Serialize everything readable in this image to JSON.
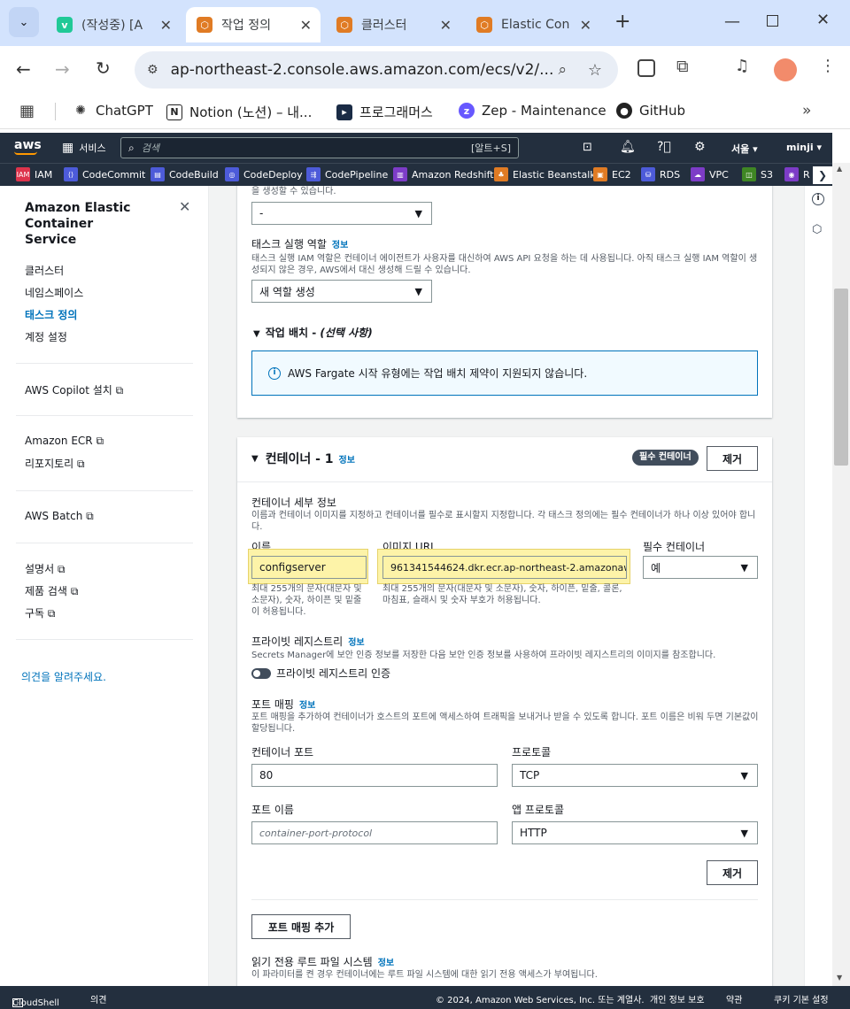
{
  "browser": {
    "tabs": [
      {
        "label": "(작성중) [A",
        "active": false
      },
      {
        "label": "작업 정의",
        "active": true
      },
      {
        "label": "클러스터",
        "active": false
      },
      {
        "label": "Elastic Con",
        "active": false
      }
    ],
    "url": "ap-northeast-2.console.aws.amazon.com/ecs/v2/...",
    "bookmarks": [
      "ChatGPT",
      "Notion (노션) – 내...",
      "프로그래머스",
      "Zep - Maintenance",
      "GitHub"
    ]
  },
  "aws_nav": {
    "logo": "aws",
    "services": "서비스",
    "search_placeholder": "검색",
    "search_shortcut": "[알트+S]",
    "region": "서울",
    "user": "minji",
    "favorites": [
      "IAM",
      "CodeCommit",
      "CodeBuild",
      "CodeDeploy",
      "CodePipeline",
      "Amazon Redshift",
      "Elastic Beanstalk",
      "EC2",
      "RDS",
      "VPC",
      "S3",
      "R"
    ]
  },
  "sidebar": {
    "title": "Amazon Elastic Container Service",
    "items": [
      "클러스터",
      "네임스페이스",
      "태스크 정의",
      "계정 설정"
    ],
    "active": "태스크 정의",
    "copilot": "AWS Copilot 설치",
    "ecr": "Amazon ECR",
    "repos": "리포지토리",
    "batch": "AWS Batch",
    "docs": "설명서",
    "product_search": "제품 검색",
    "subscribe": "구독",
    "feedback": "의견을 알려주세요."
  },
  "top_panel": {
    "cut_text": "을 생성할 수 있습니다.",
    "select_dash": "-",
    "exec_role_label": "태스크 실행 역할",
    "info": "정보",
    "exec_role_desc": "태스크 실행 IAM 역할은 컨테이너 에이전트가 사용자를 대신하여 AWS API 요청을 하는 데 사용됩니다. 아직 태스크 실행 IAM 역할이 생성되지 않은 경우, AWS에서 대신 생성해 드릴 수 있습니다.",
    "exec_role_value": "새 역할 생성",
    "placement_label": "작업 배치 - ",
    "placement_optional": "(선택 사항)",
    "placement_alert": "AWS Fargate 시작 유형에는 작업 배치 제약이 지원되지 않습니다."
  },
  "container": {
    "title": "컨테이너 - 1",
    "info": "정보",
    "essential_badge": "필수 컨테이너",
    "remove_button": "제거",
    "details_label": "컨테이너 세부 정보",
    "details_desc": "이름과 컨테이너 이미지를 지정하고 컨테이너를 필수로 표시할지 지정합니다. 각 태스크 정의에는 필수 컨테이너가 하나 이상 있어야 합니다.",
    "name_label": "이름",
    "name_value": "configserver",
    "name_hint": "최대 255개의 문자(대문자 및 소문자), 숫자, 하이픈 및 밑줄이 허용됩니다.",
    "image_label": "이미지 URI",
    "image_value": "961341544624.dkr.ecr.ap-northeast-2.amazonaw",
    "image_hint": "최대 255개의 문자(대문자 및 소문자), 숫자, 하이픈, 밑줄, 콜론, 마침표, 슬래시 및 숫자 부호가 허용됩니다.",
    "essential_label": "필수 컨테이너",
    "essential_value": "예",
    "private_reg_label": "프라이빗 레지스트리",
    "private_reg_desc": "Secrets Manager에 보안 인증 정보를 저장한 다음 보안 인증 정보를 사용하여 프라이빗 레지스트리의 이미지를 참조합니다.",
    "private_reg_toggle": "프라이빗 레지스트리 인증",
    "port_mapping_label": "포트 매핑",
    "port_mapping_desc": "포트 매핑을 추가하여 컨테이너가 호스트의 포트에 액세스하여 트래픽을 보내거나 받을 수 있도록 합니다. 포트 이름은 비워 두면 기본값이 할당됩니다.",
    "container_port_label": "컨테이너 포트",
    "container_port_value": "80",
    "protocol_label": "프로토콜",
    "protocol_value": "TCP",
    "port_name_label": "포트 이름",
    "port_name_placeholder": "container-port-protocol",
    "app_protocol_label": "앱 프로토콜",
    "app_protocol_value": "HTTP",
    "port_remove": "제거",
    "add_port_mapping": "포트 매핑 추가",
    "readonly_fs_label": "읽기 전용 루트 파일 시스템",
    "readonly_fs_desc": "이 파라미터를 켠 경우 컨테이너에는 루트 파일 시스템에 대한 읽기 전용 액세스가 부여됩니다."
  },
  "footer": {
    "cloudshell": "CloudShell",
    "feedback": "의견",
    "copyright": "© 2024, Amazon Web Services, Inc. 또는 계열사.",
    "privacy": "개인 정보 보호",
    "terms": "약관",
    "cookie": "쿠키 기본 설정"
  }
}
